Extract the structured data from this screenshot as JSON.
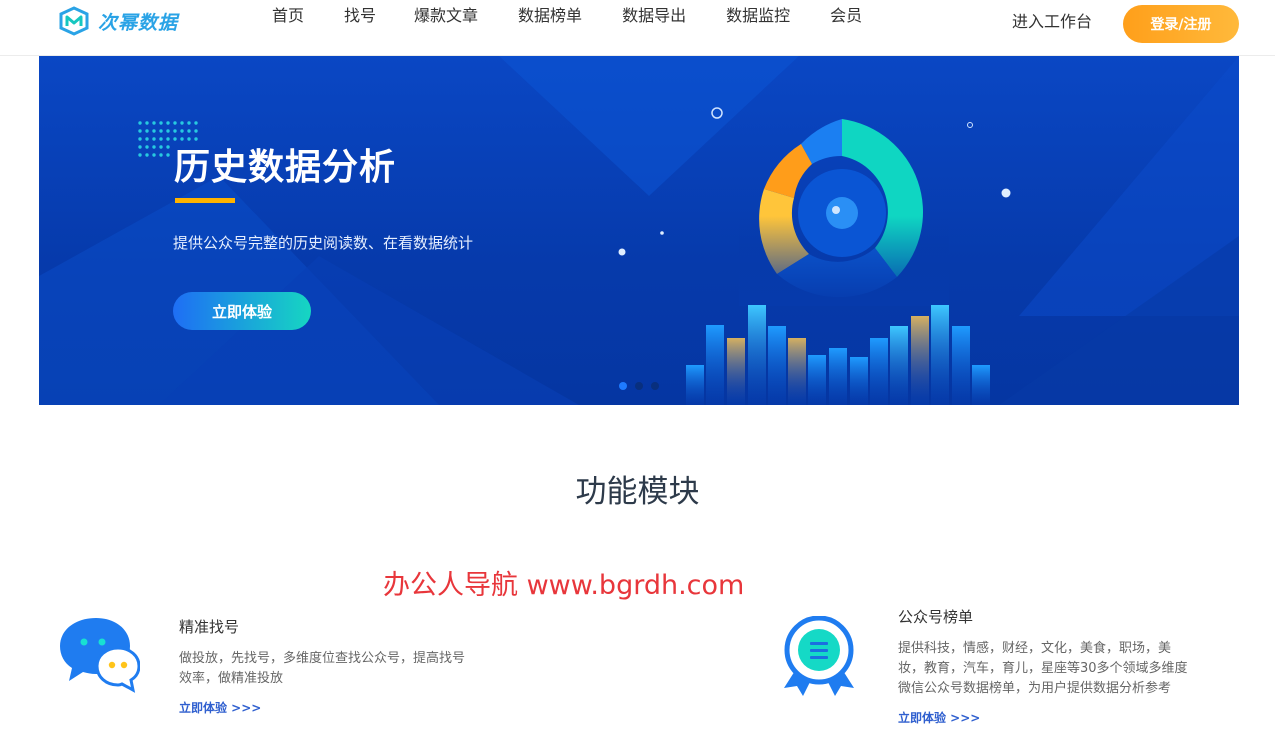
{
  "header": {
    "logo_text": "次幂数据",
    "nav": [
      "首页",
      "找号",
      "爆款文章",
      "数据榜单",
      "数据导出",
      "数据监控",
      "会员"
    ],
    "workbench": "进入工作台",
    "login": "登录/注册"
  },
  "banner": {
    "title": "历史数据分析",
    "subtitle": "提供公众号完整的历史阅读数、在看数据统计",
    "button": "立即体验",
    "carousel_index": 1,
    "carousel_total": 3
  },
  "features": {
    "title": "功能模块",
    "watermark": "办公人导航 www.bgrdh.com",
    "cards": [
      {
        "title": "精准找号",
        "desc1": "做投放，先找号，多维度位查找公众号，提高找号",
        "desc2": "效率，做精准投放",
        "link": "立即体验 >>>",
        "icon": "chat-bubbles-icon"
      },
      {
        "title": "公众号榜单",
        "desc1": "提供科技，情感，财经，文化，美食，职场，美",
        "desc2": "妆，教育，汽车，育儿，星座等30多个领域多维度",
        "desc3": "微信公众号数据榜单，为用户提供数据分析参考",
        "link": "立即体验 >>>",
        "icon": "award-badge-icon"
      }
    ]
  },
  "colors": {
    "brand": "#2aa3e6",
    "accent_orange": "#ffa51f",
    "banner_blue": "#0a47c4",
    "watermark_red": "#e8363b"
  }
}
